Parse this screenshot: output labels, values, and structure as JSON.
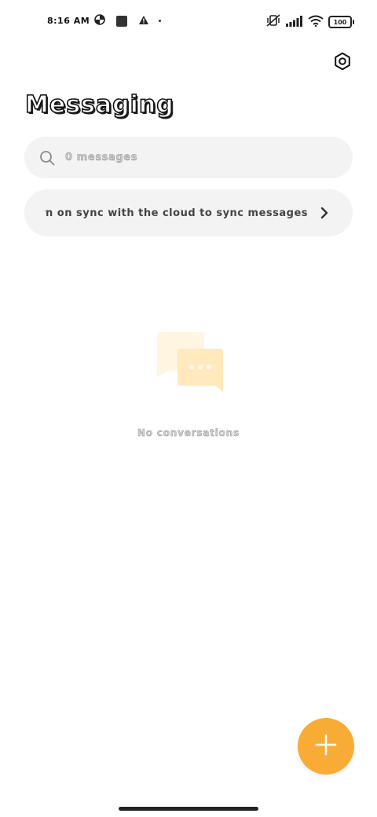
{
  "status_bar": {
    "time": "8:16 AM",
    "battery": "100"
  },
  "header": {
    "title": "Messaging",
    "settings_icon": "gear-hex-icon"
  },
  "search": {
    "placeholder": "0 messages",
    "icon": "search-icon"
  },
  "sync_banner": {
    "text": "Turn on sync with the cloud to sync messages",
    "icon": "chevron-right-icon"
  },
  "empty_state": {
    "text": "No conversations",
    "icon": "chat-bubbles-icon"
  },
  "fab": {
    "icon": "plus-icon"
  },
  "colors": {
    "accent": "#f9ac35",
    "surface": "#f3f3f3",
    "illustration_light": "#fff5e0",
    "illustration": "#ffe9bd"
  }
}
